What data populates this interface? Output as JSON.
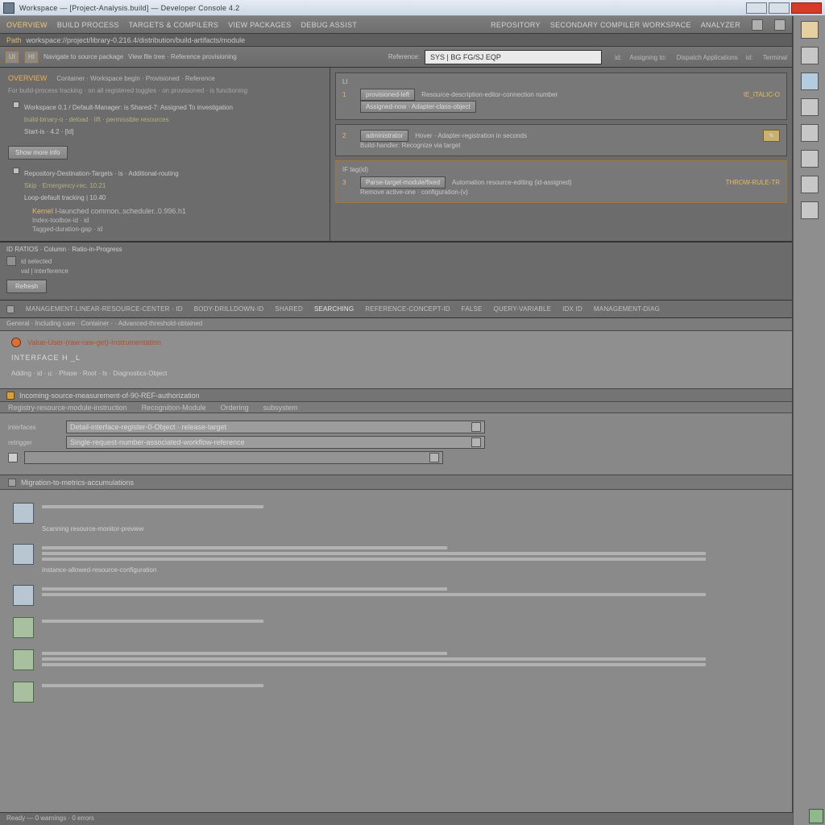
{
  "titlebar": {
    "text": "Workspace — [Project-Analysis.build] — Developer Console 4.2"
  },
  "menu": {
    "left": [
      "Overview",
      "Build Process",
      "Targets & Compilers",
      "View Packages",
      "Debug Assist"
    ],
    "right": [
      "Repository",
      "Secondary Compiler Workspace",
      "Analyzer"
    ]
  },
  "breadcrumb": {
    "label": "Path",
    "text": "workspace://project/library-0.216.4/distribution/build-artifacts/module"
  },
  "toolbar": {
    "chip1": "UI",
    "chip2": "HI",
    "label1": "Navigate to source package",
    "label2": "View file tree · Reference provisioning",
    "searchLabel": "Reference:",
    "searchValue": "SYS | BG FG/SJ EQP",
    "tail": [
      "id:",
      "Assigning to:",
      "Dispatch Applications",
      "id:",
      "Terminal"
    ]
  },
  "overview": {
    "title": "Overview",
    "crumbs": "Container · Workspace begin · Provisioned · Reference",
    "meta": "For build-process tracking · on all registered toggles · on provisioned · is functioning",
    "p1": "Workspace 0.1 / Default-Manager: is Shared-7: Assigned To investigation",
    "p2": "build-binary-o · deload · lift · permissible resources",
    "p3": "Start-is · 4.2 · [ld]",
    "moreBtn": "Show more info",
    "b2": {
      "t": "Repository-Destination-Targets · is  ·  Additional-routing",
      "s": "Skip · Emergency-rec. 10.21",
      "s2": "Loop-default tracking | 10.40"
    },
    "k1": "Kernel",
    "k1v": "I-launched common..scheduler..0.996.h1",
    "k2": "Index-toolbox-id · id",
    "k3": "Tagged-duration-gap · id"
  },
  "cards": [
    {
      "idx": "1",
      "hdr": "LI",
      "pill": "provisioned-left",
      "val": "Resource-description-editor-connection number",
      "end": "IE_ITALIC-O",
      "sub": "Assigned-now · Adapter-class-object"
    },
    {
      "idx": "2",
      "hdr": "",
      "pill": "administrator",
      "val": "Hover · Adapter-registration in seconds",
      "end": "",
      "sub": "Build-handler: Recognize via target"
    },
    {
      "idx": "3",
      "hdr": "IF tag(id)",
      "pill": "Parse-target-module/fixed",
      "val": "Automation resource-editing (id-assigned)",
      "end": "THROW-RULE-TR",
      "sub": "Remove active-one · configuration-(v)"
    }
  ],
  "mid": {
    "h": "ID RATIOS · Column · Ratio-in-Progress",
    "row1": "id selected",
    "row2": "val | interference",
    "btn": "Refresh"
  },
  "tabs": [
    "",
    "management-linear-resource-center · id",
    "body-drilldown-id",
    "shared",
    "Searching",
    "Reference-Concept-id",
    "false",
    "Query-variable",
    "idx   id",
    "",
    "management-diag"
  ],
  "msg": {
    "sub": "General · Including care · Container ·   · Advanced-threshold-obtained",
    "warn": "Value-User-(raw-raw-get)-Instrumentation",
    "code": "INTERFACE  H   _L",
    "foot": "Adding · id · u: · Phase · Root · Is · Diagnostics-Object"
  },
  "form": {
    "hdr": "Incoming-source-measurement-of-90-REF-authorization",
    "subs": [
      "Registry-resource-module-instruction",
      "Recognition-Module",
      "Ordering",
      "subsystem"
    ],
    "rows": [
      {
        "label": "interfaces",
        "val": "Detail-interface-register-0-Object  ·  release-target"
      },
      {
        "label": "retrigger",
        "val": "Single-request-number-associated-workflow-reference"
      },
      {
        "label": "",
        "val": ""
      }
    ]
  },
  "results": {
    "hdr": "Migration-to-metrics-accumulations",
    "note1": "Scanning resource-monitor-preview",
    "note2": "Instance-allowed-resource-configuration"
  },
  "status": "Ready — 0 warnings · 0 errors"
}
